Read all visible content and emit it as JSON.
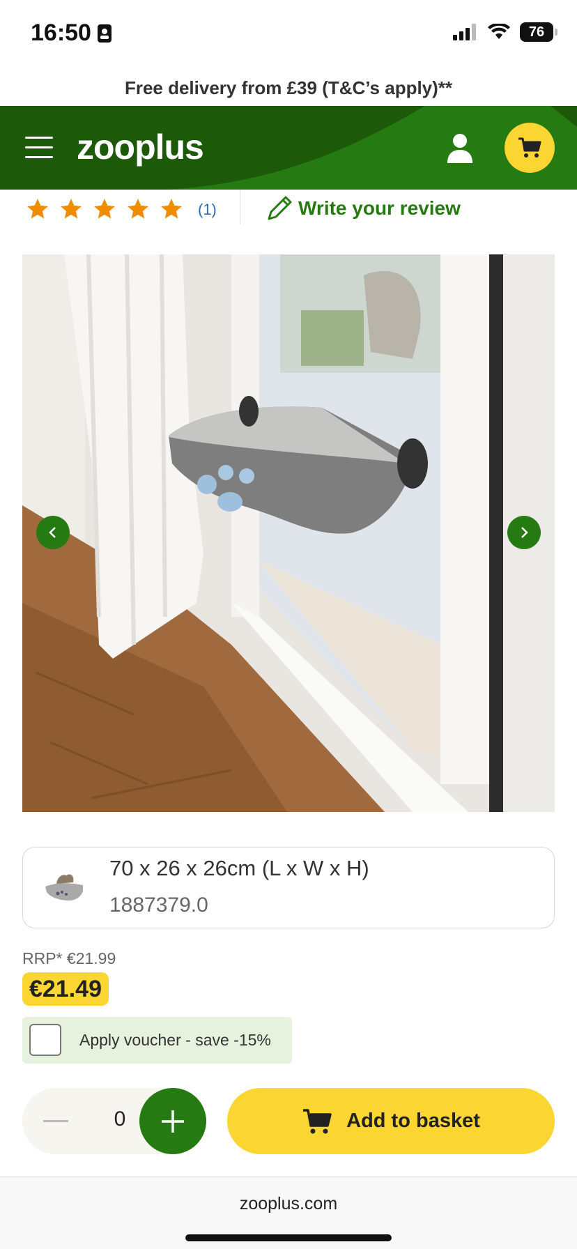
{
  "status_bar": {
    "time": "16:50",
    "battery": "76"
  },
  "promo": {
    "text": "Free delivery from £39 (T&C’s apply)**"
  },
  "header": {
    "logo": "zooplus",
    "colors": {
      "brand_green": "#267a12",
      "dark_green": "#1c5a0a",
      "cart_yellow": "#fbd531"
    }
  },
  "rating": {
    "stars": 5,
    "count": "(1)",
    "write_review": "Write your review"
  },
  "gallery": {
    "icons": {
      "prev": "chevron-left-icon",
      "next": "chevron-right-icon"
    }
  },
  "variant": {
    "size": "70 x 26 x 26cm (L x W x H)",
    "sku": "1887379.0"
  },
  "pricing": {
    "rrp": "RRP* €21.99",
    "price": "€21.49"
  },
  "voucher": {
    "label": "Apply voucher - save -15%"
  },
  "quantity": {
    "value": "0"
  },
  "basket": {
    "label": "Add to basket"
  },
  "browser": {
    "domain": "zooplus.com"
  }
}
